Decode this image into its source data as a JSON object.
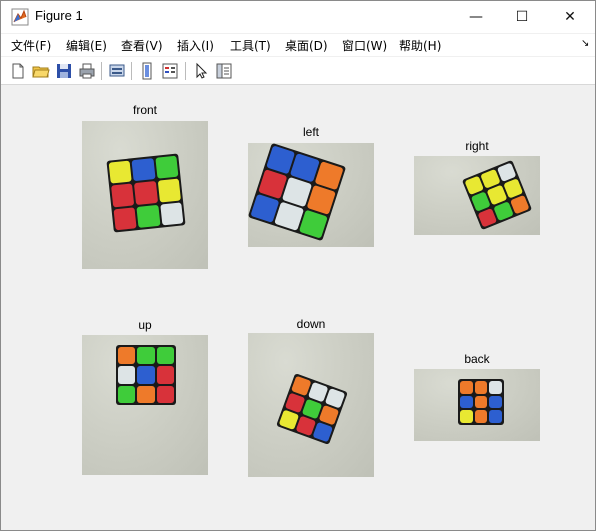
{
  "window": {
    "title": "Figure 1",
    "min_glyph": "—",
    "max_glyph": "☐",
    "close_glyph": "✕"
  },
  "menu": [
    "文件(F)",
    "编辑(E)",
    "查看(V)",
    "插入(I)",
    "工具(T)",
    "桌面(D)",
    "窗口(W)",
    "帮助(H)"
  ],
  "menu_overflow": "↘",
  "toolbar": [
    "new-figure-icon",
    "open-icon",
    "save-icon",
    "print-icon",
    "print-preview-icon",
    "link-icon",
    "colorbar-icon",
    "cursor-icon",
    "property-inspector-icon"
  ],
  "colors": {
    "red": "#d8323a",
    "green": "#3fcc3a",
    "blue": "#2d5fd0",
    "yellow": "#e8e832",
    "white": "#dde4e6",
    "orange": "#ee7a2a",
    "lime": "#b8e840"
  },
  "subplots": [
    {
      "title": "front",
      "faces": [
        "yellow",
        "blue",
        "green",
        "red",
        "red",
        "yellow",
        "red",
        "green",
        "white"
      ]
    },
    {
      "title": "left",
      "faces": [
        "blue",
        "blue",
        "orange",
        "red",
        "white",
        "orange",
        "blue",
        "white",
        "green"
      ]
    },
    {
      "title": "right",
      "faces": [
        "yellow",
        "yellow",
        "white",
        "green",
        "yellow",
        "yellow",
        "red",
        "green",
        "orange"
      ]
    },
    {
      "title": "up",
      "faces": [
        "orange",
        "green",
        "green",
        "white",
        "blue",
        "red",
        "green",
        "orange",
        "red"
      ]
    },
    {
      "title": "down",
      "faces": [
        "orange",
        "white",
        "white",
        "red",
        "green",
        "orange",
        "yellow",
        "red",
        "blue"
      ]
    },
    {
      "title": "back",
      "faces": [
        "orange",
        "orange",
        "white",
        "blue",
        "orange",
        "blue",
        "yellow",
        "orange",
        "blue"
      ]
    }
  ]
}
